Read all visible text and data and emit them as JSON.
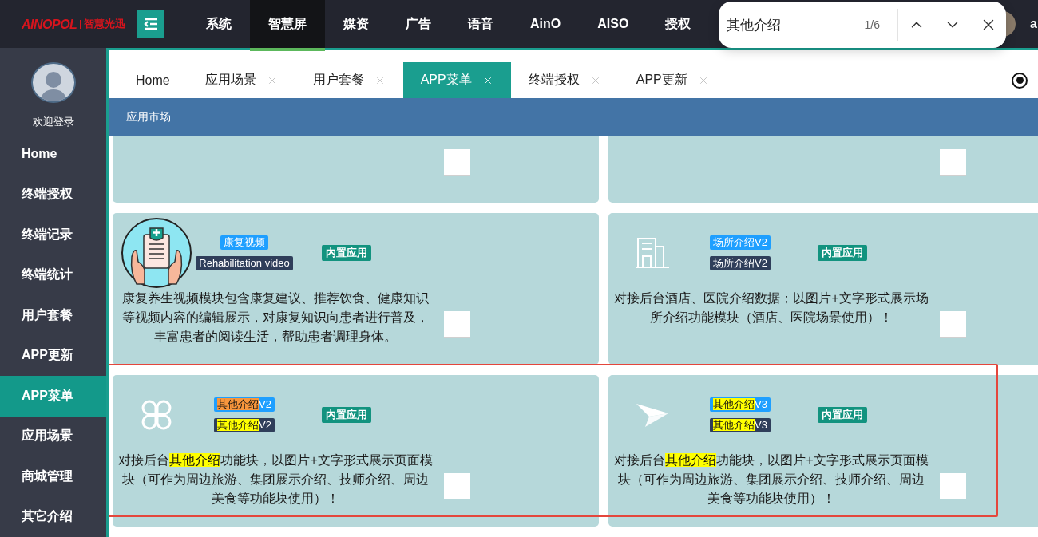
{
  "header": {
    "logo": {
      "brand": "AINOPOL",
      "tagline": "智慧光迅"
    },
    "nav": [
      {
        "label": "系统",
        "selected": false
      },
      {
        "label": "智慧屏",
        "selected": true
      },
      {
        "label": "媒资",
        "selected": false
      },
      {
        "label": "广告",
        "selected": false
      },
      {
        "label": "语音",
        "selected": false
      },
      {
        "label": "AinO",
        "selected": false
      },
      {
        "label": "AISO",
        "selected": false
      },
      {
        "label": "授权",
        "selected": false
      }
    ],
    "user": {
      "name": "a"
    }
  },
  "find_bar": {
    "query": "其他介绍",
    "count": "1/6"
  },
  "sidebar": {
    "greeting": "欢迎登录",
    "items": [
      {
        "label": "Home",
        "selected": false
      },
      {
        "label": "终端授权",
        "selected": false
      },
      {
        "label": "终端记录",
        "selected": false
      },
      {
        "label": "终端统计",
        "selected": false
      },
      {
        "label": "用户套餐",
        "selected": false
      },
      {
        "label": "APP更新",
        "selected": false
      },
      {
        "label": "APP菜单",
        "selected": true
      },
      {
        "label": "应用场景",
        "selected": false
      },
      {
        "label": "商城管理",
        "selected": false
      },
      {
        "label": "其它介绍",
        "selected": false
      }
    ]
  },
  "tabs": [
    {
      "label": "Home",
      "closable": false,
      "selected": false
    },
    {
      "label": "应用场景",
      "closable": true,
      "selected": false
    },
    {
      "label": "用户套餐",
      "closable": true,
      "selected": false
    },
    {
      "label": "APP菜单",
      "closable": true,
      "selected": true
    },
    {
      "label": "终端授权",
      "closable": true,
      "selected": false
    },
    {
      "label": "APP更新",
      "closable": true,
      "selected": false
    }
  ],
  "page_option": {
    "selected": true
  },
  "section": {
    "title": "应用市场"
  },
  "cards": [
    {
      "checked": false
    },
    {
      "checked": false
    },
    {
      "name": [
        {
          "text": "康复视频"
        }
      ],
      "subtitle": [
        {
          "text": "Rehabilitation video"
        }
      ],
      "badge": "内置应用",
      "description": [
        {
          "text": "康复养生视频模块包含康复建议、推荐饮食、健康知识等视频内容的编辑展示，对康复知识向患者进行普及，丰富患者的阅读生活，帮助患者调理身体。"
        }
      ],
      "checked": false
    },
    {
      "name": [
        {
          "text": "场所介绍V2"
        }
      ],
      "subtitle": [
        {
          "text": "场所介绍V2"
        }
      ],
      "badge": "内置应用",
      "description": [
        {
          "text": "对接后台酒店、医院介绍数据；以图片+文字形式展示场所介绍功能模块（酒店、医院场景使用）！"
        }
      ],
      "checked": false
    },
    {
      "name": [
        {
          "text": "其他介绍",
          "highlighted": true,
          "current": true
        },
        {
          "text": "V2"
        }
      ],
      "subtitle": [
        {
          "text": "其他介绍",
          "highlighted": true,
          "current": false
        },
        {
          "text": "V2"
        }
      ],
      "badge": "内置应用",
      "description": [
        {
          "text": "对接后台"
        },
        {
          "text": "其他介绍",
          "highlighted": true,
          "current": false
        },
        {
          "text": "功能块，以图片+文字形式展示页面模块（可作为周边旅游、集团展示介绍、技师介绍、周边美食等功能块使用）！"
        }
      ],
      "checked": false
    },
    {
      "name": [
        {
          "text": "其他介绍",
          "highlighted": true,
          "current": false
        },
        {
          "text": "V3"
        }
      ],
      "subtitle": [
        {
          "text": "其他介绍",
          "highlighted": true,
          "current": false
        },
        {
          "text": "V3"
        }
      ],
      "badge": "内置应用",
      "description": [
        {
          "text": "对接后台"
        },
        {
          "text": "其他介绍",
          "highlighted": true,
          "current": false
        },
        {
          "text": "功能块，以图片+文字形式展示页面模块（可作为周边旅游、集团展示介绍、技师介绍、周边美食等功能块使用）！"
        }
      ],
      "checked": false
    }
  ]
}
